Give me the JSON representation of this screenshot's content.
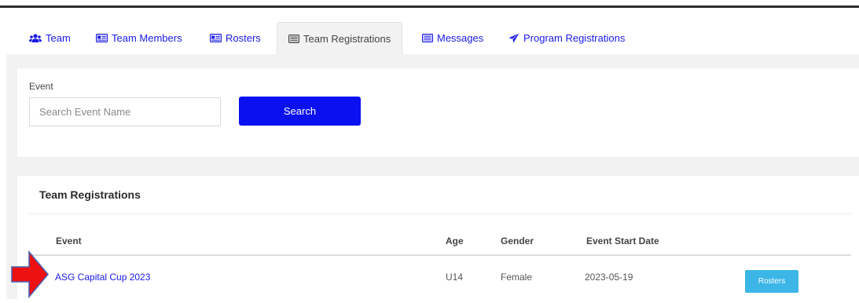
{
  "tabs": [
    {
      "label": "Team",
      "icon": "users-icon"
    },
    {
      "label": "Team Members",
      "icon": "id-card-icon"
    },
    {
      "label": "Rosters",
      "icon": "id-card-icon"
    },
    {
      "label": "Team Registrations",
      "icon": "list-icon",
      "active": true
    },
    {
      "label": "Messages",
      "icon": "list-icon"
    },
    {
      "label": "Program Registrations",
      "icon": "paper-plane-icon"
    }
  ],
  "search": {
    "label": "Event",
    "placeholder": "Search Event Name",
    "value": "",
    "button_label": "Search"
  },
  "registrations": {
    "title": "Team Registrations",
    "columns": [
      "Event",
      "Age",
      "Gender",
      "Event Start Date"
    ],
    "rows": [
      {
        "event": "ASG Capital Cup 2023",
        "age": "U14",
        "gender": "Female",
        "start_date": "2023-05-19",
        "action_label": "Rosters"
      }
    ]
  },
  "colors": {
    "link": "#1a1ae6",
    "primary_button": "#0a10f0",
    "info_button": "#3bb6e6",
    "annotation_arrow": "#ee1111"
  }
}
